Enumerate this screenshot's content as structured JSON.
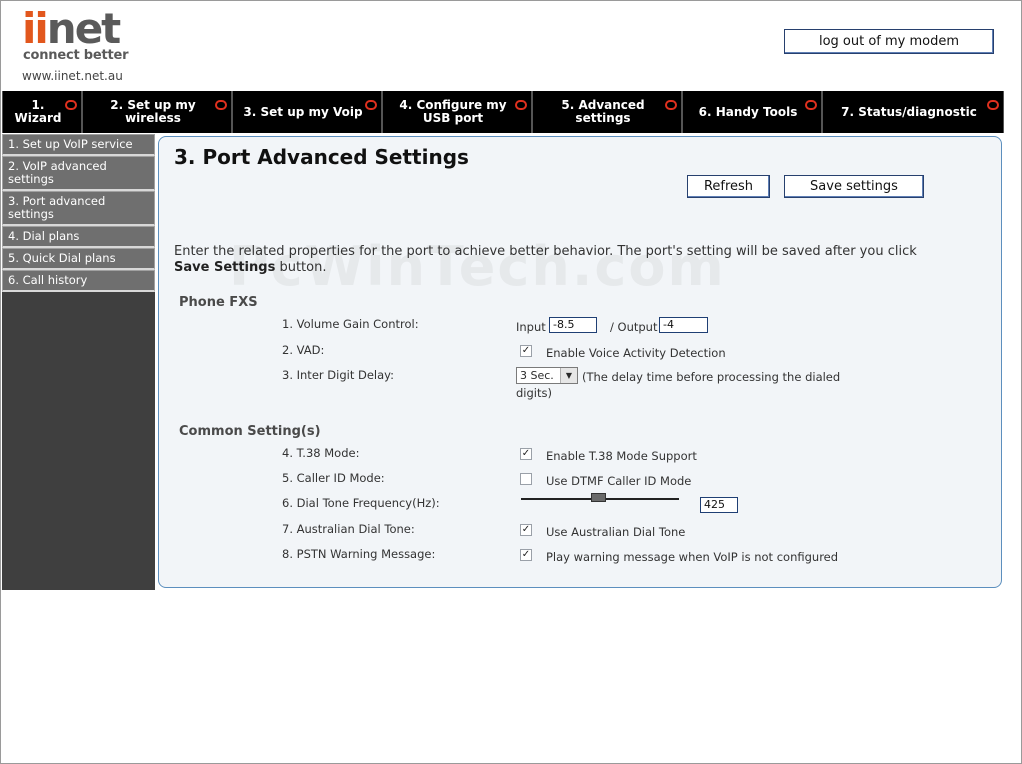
{
  "header": {
    "logo_brand_1": "ii",
    "logo_brand_2": "net",
    "logo_tagline": "connect better",
    "logo_url": "www.iinet.net.au",
    "logout_label": "log out of my modem"
  },
  "nav": {
    "tabs": [
      {
        "label": "1. Wizard"
      },
      {
        "label": "2. Set up my wireless"
      },
      {
        "label": "3. Set up my Voip"
      },
      {
        "label": "4. Configure my USB port"
      },
      {
        "label": "5. Advanced settings"
      },
      {
        "label": "6. Handy Tools"
      },
      {
        "label": "7. Status/diagnostic"
      }
    ]
  },
  "sidebar": {
    "items": [
      {
        "label": "1. Set up VoIP service"
      },
      {
        "label": "2. VoIP advanced settings"
      },
      {
        "label": "3. Port advanced settings"
      },
      {
        "label": "4. Dial plans"
      },
      {
        "label": "5. Quick Dial plans"
      },
      {
        "label": "6. Call history"
      }
    ]
  },
  "main": {
    "title": "3. Port Advanced Settings",
    "refresh_label": "Refresh",
    "save_label": "Save settings",
    "intro_text": "Enter the related properties for the port to achieve better behavior. The port's setting will be saved after you click ",
    "intro_bold": "Save Settings",
    "intro_tail": " button.",
    "watermark": "PcWinTech.com"
  },
  "phone_fxs": {
    "heading": "Phone FXS",
    "volume_label": "1. Volume Gain Control:",
    "input_label": "Input",
    "input_value": "-8.5",
    "output_label": "/ Output",
    "output_value": "-4",
    "vad_label": "2. VAD:",
    "vad_checked": true,
    "vad_text": "Enable Voice Activity Detection",
    "delay_label": "3. Inter Digit Delay:",
    "delay_value": "3 Sec.",
    "delay_note_1": "(The delay time before processing the dialed",
    "delay_note_2": "digits)"
  },
  "common": {
    "heading": "Common Setting(s)",
    "t38_label": "4. T.38 Mode:",
    "t38_checked": true,
    "t38_text": "Enable T.38 Mode Support",
    "callerid_label": "5. Caller ID Mode:",
    "callerid_checked": false,
    "callerid_text": "Use DTMF Caller ID Mode",
    "dialtone_label": "6. Dial Tone Frequency(Hz):",
    "dialtone_value": "425",
    "aus_label": "7. Australian Dial Tone:",
    "aus_checked": true,
    "aus_text": "Use Australian Dial Tone",
    "pstn_label": "8. PSTN Warning Message:",
    "pstn_checked": true,
    "pstn_text": "Play warning message when VoIP is not configured"
  },
  "icons": {
    "checkmark": "✓",
    "dropdown_arrow": "▼"
  },
  "colors": {
    "brand_orange": "#e2571d",
    "nav_bg": "#000000",
    "nav_dot": "#e0301e",
    "panel_border": "#5c8fbe"
  }
}
